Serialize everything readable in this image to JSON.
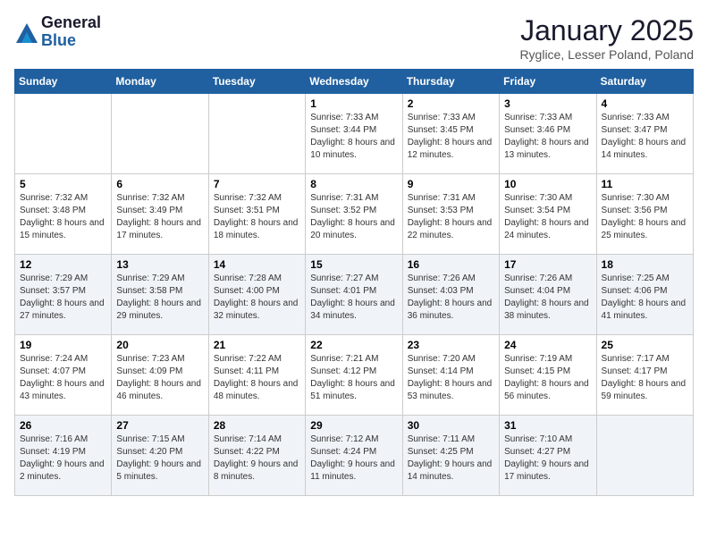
{
  "logo": {
    "general": "General",
    "blue": "Blue"
  },
  "header": {
    "month": "January 2025",
    "location": "Ryglice, Lesser Poland, Poland"
  },
  "weekdays": [
    "Sunday",
    "Monday",
    "Tuesday",
    "Wednesday",
    "Thursday",
    "Friday",
    "Saturday"
  ],
  "weeks": [
    [
      {
        "day": "",
        "info": ""
      },
      {
        "day": "",
        "info": ""
      },
      {
        "day": "",
        "info": ""
      },
      {
        "day": "1",
        "sunrise": "Sunrise: 7:33 AM",
        "sunset": "Sunset: 3:44 PM",
        "daylight": "Daylight: 8 hours and 10 minutes."
      },
      {
        "day": "2",
        "sunrise": "Sunrise: 7:33 AM",
        "sunset": "Sunset: 3:45 PM",
        "daylight": "Daylight: 8 hours and 12 minutes."
      },
      {
        "day": "3",
        "sunrise": "Sunrise: 7:33 AM",
        "sunset": "Sunset: 3:46 PM",
        "daylight": "Daylight: 8 hours and 13 minutes."
      },
      {
        "day": "4",
        "sunrise": "Sunrise: 7:33 AM",
        "sunset": "Sunset: 3:47 PM",
        "daylight": "Daylight: 8 hours and 14 minutes."
      }
    ],
    [
      {
        "day": "5",
        "sunrise": "Sunrise: 7:32 AM",
        "sunset": "Sunset: 3:48 PM",
        "daylight": "Daylight: 8 hours and 15 minutes."
      },
      {
        "day": "6",
        "sunrise": "Sunrise: 7:32 AM",
        "sunset": "Sunset: 3:49 PM",
        "daylight": "Daylight: 8 hours and 17 minutes."
      },
      {
        "day": "7",
        "sunrise": "Sunrise: 7:32 AM",
        "sunset": "Sunset: 3:51 PM",
        "daylight": "Daylight: 8 hours and 18 minutes."
      },
      {
        "day": "8",
        "sunrise": "Sunrise: 7:31 AM",
        "sunset": "Sunset: 3:52 PM",
        "daylight": "Daylight: 8 hours and 20 minutes."
      },
      {
        "day": "9",
        "sunrise": "Sunrise: 7:31 AM",
        "sunset": "Sunset: 3:53 PM",
        "daylight": "Daylight: 8 hours and 22 minutes."
      },
      {
        "day": "10",
        "sunrise": "Sunrise: 7:30 AM",
        "sunset": "Sunset: 3:54 PM",
        "daylight": "Daylight: 8 hours and 24 minutes."
      },
      {
        "day": "11",
        "sunrise": "Sunrise: 7:30 AM",
        "sunset": "Sunset: 3:56 PM",
        "daylight": "Daylight: 8 hours and 25 minutes."
      }
    ],
    [
      {
        "day": "12",
        "sunrise": "Sunrise: 7:29 AM",
        "sunset": "Sunset: 3:57 PM",
        "daylight": "Daylight: 8 hours and 27 minutes."
      },
      {
        "day": "13",
        "sunrise": "Sunrise: 7:29 AM",
        "sunset": "Sunset: 3:58 PM",
        "daylight": "Daylight: 8 hours and 29 minutes."
      },
      {
        "day": "14",
        "sunrise": "Sunrise: 7:28 AM",
        "sunset": "Sunset: 4:00 PM",
        "daylight": "Daylight: 8 hours and 32 minutes."
      },
      {
        "day": "15",
        "sunrise": "Sunrise: 7:27 AM",
        "sunset": "Sunset: 4:01 PM",
        "daylight": "Daylight: 8 hours and 34 minutes."
      },
      {
        "day": "16",
        "sunrise": "Sunrise: 7:26 AM",
        "sunset": "Sunset: 4:03 PM",
        "daylight": "Daylight: 8 hours and 36 minutes."
      },
      {
        "day": "17",
        "sunrise": "Sunrise: 7:26 AM",
        "sunset": "Sunset: 4:04 PM",
        "daylight": "Daylight: 8 hours and 38 minutes."
      },
      {
        "day": "18",
        "sunrise": "Sunrise: 7:25 AM",
        "sunset": "Sunset: 4:06 PM",
        "daylight": "Daylight: 8 hours and 41 minutes."
      }
    ],
    [
      {
        "day": "19",
        "sunrise": "Sunrise: 7:24 AM",
        "sunset": "Sunset: 4:07 PM",
        "daylight": "Daylight: 8 hours and 43 minutes."
      },
      {
        "day": "20",
        "sunrise": "Sunrise: 7:23 AM",
        "sunset": "Sunset: 4:09 PM",
        "daylight": "Daylight: 8 hours and 46 minutes."
      },
      {
        "day": "21",
        "sunrise": "Sunrise: 7:22 AM",
        "sunset": "Sunset: 4:11 PM",
        "daylight": "Daylight: 8 hours and 48 minutes."
      },
      {
        "day": "22",
        "sunrise": "Sunrise: 7:21 AM",
        "sunset": "Sunset: 4:12 PM",
        "daylight": "Daylight: 8 hours and 51 minutes."
      },
      {
        "day": "23",
        "sunrise": "Sunrise: 7:20 AM",
        "sunset": "Sunset: 4:14 PM",
        "daylight": "Daylight: 8 hours and 53 minutes."
      },
      {
        "day": "24",
        "sunrise": "Sunrise: 7:19 AM",
        "sunset": "Sunset: 4:15 PM",
        "daylight": "Daylight: 8 hours and 56 minutes."
      },
      {
        "day": "25",
        "sunrise": "Sunrise: 7:17 AM",
        "sunset": "Sunset: 4:17 PM",
        "daylight": "Daylight: 8 hours and 59 minutes."
      }
    ],
    [
      {
        "day": "26",
        "sunrise": "Sunrise: 7:16 AM",
        "sunset": "Sunset: 4:19 PM",
        "daylight": "Daylight: 9 hours and 2 minutes."
      },
      {
        "day": "27",
        "sunrise": "Sunrise: 7:15 AM",
        "sunset": "Sunset: 4:20 PM",
        "daylight": "Daylight: 9 hours and 5 minutes."
      },
      {
        "day": "28",
        "sunrise": "Sunrise: 7:14 AM",
        "sunset": "Sunset: 4:22 PM",
        "daylight": "Daylight: 9 hours and 8 minutes."
      },
      {
        "day": "29",
        "sunrise": "Sunrise: 7:12 AM",
        "sunset": "Sunset: 4:24 PM",
        "daylight": "Daylight: 9 hours and 11 minutes."
      },
      {
        "day": "30",
        "sunrise": "Sunrise: 7:11 AM",
        "sunset": "Sunset: 4:25 PM",
        "daylight": "Daylight: 9 hours and 14 minutes."
      },
      {
        "day": "31",
        "sunrise": "Sunrise: 7:10 AM",
        "sunset": "Sunset: 4:27 PM",
        "daylight": "Daylight: 9 hours and 17 minutes."
      },
      {
        "day": "",
        "info": ""
      }
    ]
  ]
}
